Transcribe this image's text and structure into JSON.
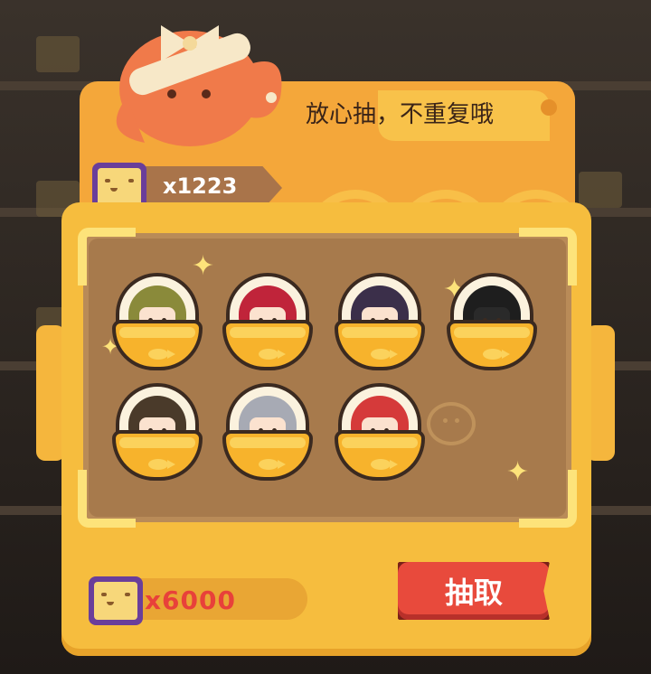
{
  "banner": {
    "text": "放心抽，不重复哦"
  },
  "currency": {
    "count": "x1223",
    "icon": "ticket-icon"
  },
  "characters": [
    {
      "name": "character-capsule-1",
      "hair": "#8a8a3a"
    },
    {
      "name": "character-capsule-2",
      "hair": "#c0243a"
    },
    {
      "name": "character-capsule-3",
      "hair": "#3b2f4a"
    },
    {
      "name": "character-capsule-4",
      "hair": "#1e1e1e"
    },
    {
      "name": "character-capsule-5",
      "hair": "#4a3a2a"
    },
    {
      "name": "character-capsule-6",
      "hair": "#a7aab4"
    },
    {
      "name": "character-capsule-7",
      "hair": "#d53a3a"
    }
  ],
  "cost": {
    "amount": "x6000"
  },
  "draw_button": {
    "label": "抽取"
  },
  "colors": {
    "accent": "#f6bd3e",
    "button": "#e84a3c",
    "cost_text": "#e8413a"
  }
}
